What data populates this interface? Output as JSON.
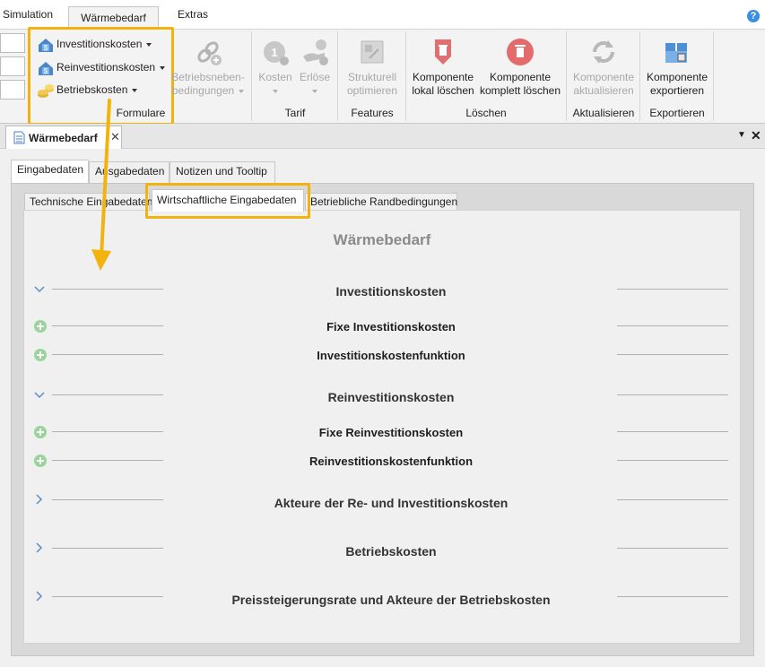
{
  "menubar": {
    "tabs": [
      "Simulation",
      "Wärmebedarf",
      "Extras"
    ],
    "active_tab": "Wärmebedarf",
    "help_label": "?"
  },
  "ribbon": {
    "formulare": {
      "items": [
        "Investitionskosten",
        "Reinvestitionskosten",
        "Betriebskosten"
      ],
      "group_label": "Formulare"
    },
    "nebenbedingungen": {
      "line1": "Betriebsneben-",
      "line2": "bedingungen"
    },
    "tarif": {
      "kosten": "Kosten",
      "erloese": "Erlöse",
      "group_label": "Tarif"
    },
    "features": {
      "line1": "Strukturell",
      "line2": "optimieren",
      "group_label": "Features"
    },
    "loeschen": {
      "lokal_line1": "Komponente",
      "lokal_line2": "lokal löschen",
      "komplett_line1": "Komponente",
      "komplett_line2": "komplett löschen",
      "group_label": "Löschen"
    },
    "aktualisieren": {
      "line1": "Komponente",
      "line2": "aktualisieren",
      "group_label": "Aktualisieren"
    },
    "exportieren": {
      "line1": "Komponente",
      "line2": "exportieren",
      "group_label": "Exportieren"
    }
  },
  "document": {
    "tab_title": "Wärmebedarf"
  },
  "outer_tabs": [
    "Eingabedaten",
    "Ausgabedaten",
    "Notizen und Tooltip"
  ],
  "inner_tabs": [
    "Technische Eingabedaten",
    "Wirtschaftliche Eingabedaten",
    "Betriebliche Randbedingungen"
  ],
  "form": {
    "title": "Wärmebedarf",
    "sections": {
      "investition": "Investitionskosten",
      "fixe_investition": "Fixe Investitionskosten",
      "investition_funktion": "Investitionskostenfunktion",
      "reinvestition": "Reinvestitionskosten",
      "fixe_reinvestition": "Fixe Reinvestitionskosten",
      "reinvestition_funktion": "Reinvestitionskostenfunktion",
      "akteure": "Akteure der Re- und Investitionskosten",
      "betrieb": "Betriebskosten",
      "preissteigerung": "Preissteigerungsrate und Akteure der Betriebskosten"
    }
  },
  "colors": {
    "highlight": "#f3b30f",
    "delete_red": "#e06060",
    "plus_green": "#9bd49b",
    "help_blue": "#3a8ee6"
  }
}
